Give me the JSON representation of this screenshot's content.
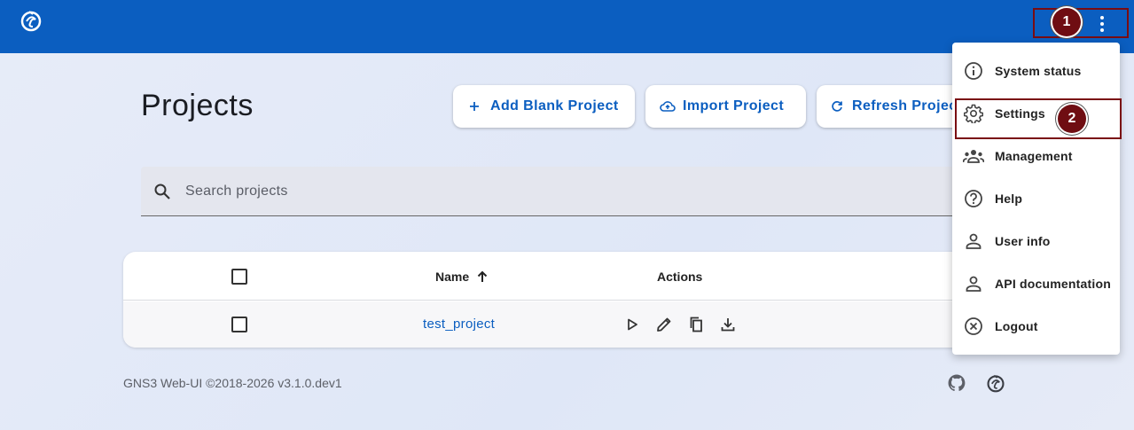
{
  "header": {
    "brand_color": "#0b5ec0",
    "logo_icon": "gns3-logo-icon",
    "menu_icon": "more-vert-icon"
  },
  "annotations": {
    "marker_1": "1",
    "marker_2": "2",
    "marker_color": "#6f0d12"
  },
  "page": {
    "title": "Projects"
  },
  "toolbar": {
    "add_label": "Add Blank Project",
    "import_label": "Import Project",
    "refresh_label": "Refresh Projects"
  },
  "search": {
    "placeholder": "Search projects",
    "value": ""
  },
  "table": {
    "columns": {
      "name": "Name",
      "actions": "Actions"
    },
    "sort_icon": "arrow-up-icon",
    "rows": [
      {
        "name": "test_project",
        "actions": [
          "play-icon",
          "edit-icon",
          "copy-icon",
          "download-icon"
        ]
      }
    ]
  },
  "footer": {
    "copyright": "GNS3 Web-UI ©2018-2026 v3.1.0.dev1",
    "icons": [
      "github-icon",
      "gns3-logo-icon"
    ]
  },
  "menu": {
    "items": [
      {
        "label": "System status",
        "icon": "info-icon"
      },
      {
        "label": "Settings",
        "icon": "gear-icon"
      },
      {
        "label": "Management",
        "icon": "groups-icon"
      },
      {
        "label": "Help",
        "icon": "help-icon"
      },
      {
        "label": "User info",
        "icon": "person-icon"
      },
      {
        "label": "API documentation",
        "icon": "person-icon"
      },
      {
        "label": "Logout",
        "icon": "cancel-icon"
      }
    ]
  }
}
